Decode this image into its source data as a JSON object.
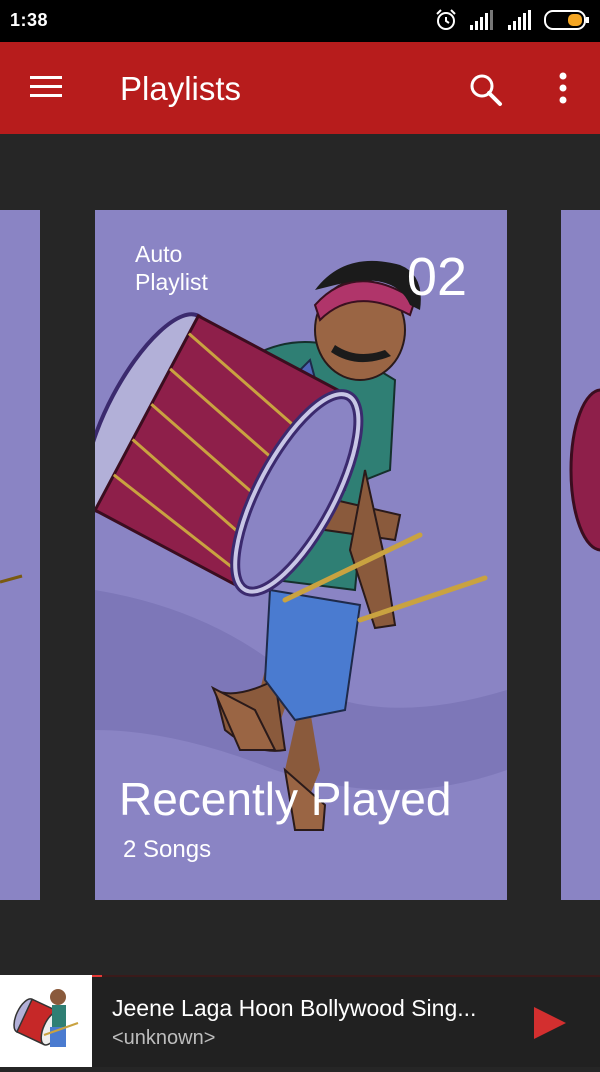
{
  "status_bar": {
    "time": "1:38",
    "icons": [
      "alarm-icon",
      "signal-icon",
      "signal-icon",
      "battery-icon"
    ]
  },
  "app_bar": {
    "title": "Playlists",
    "icons": [
      "menu-icon",
      "search-icon",
      "more-vert-icon"
    ]
  },
  "playlists": [
    {
      "tag": "Auto Playlist",
      "number": "02",
      "name": "Recently Played",
      "count": "2 Songs"
    }
  ],
  "now_playing": {
    "title": "Jeene Laga Hoon Bollywood Sing...",
    "artist": "<unknown>",
    "progress": 0.02
  },
  "colors": {
    "app_bar": "#b71c1c",
    "background": "#262626",
    "card": "#8a84c4",
    "accent": "#e53935"
  }
}
